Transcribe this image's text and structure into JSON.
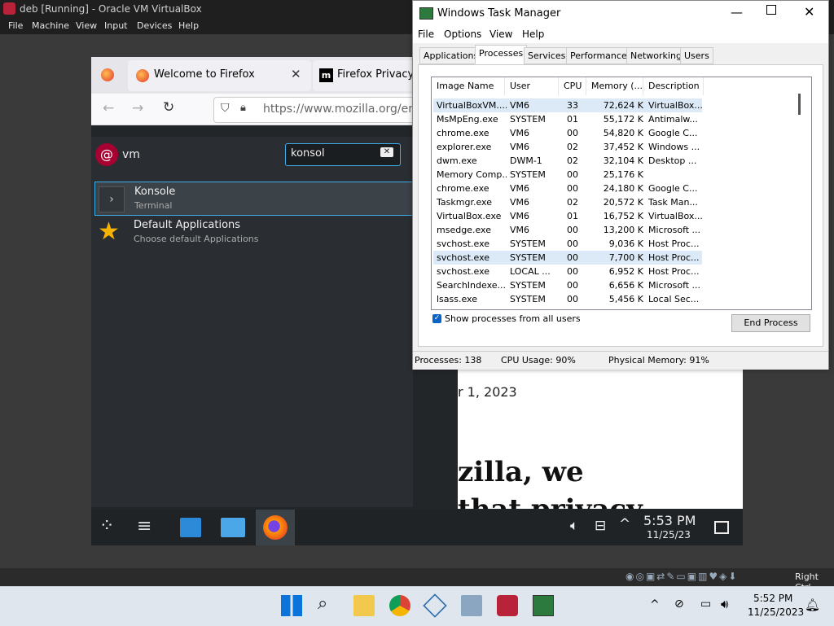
{
  "host": {
    "window_title": "deb [Running] - Oracle VM VirtualBox",
    "menu": [
      "File",
      "Machine",
      "View",
      "Input",
      "Devices",
      "Help"
    ],
    "status_right": "Right Ctrl",
    "taskbar": {
      "time": "5:52 PM",
      "date": "11/25/2023"
    }
  },
  "firefox": {
    "tabs": [
      {
        "label": "Welcome to Firefox"
      },
      {
        "label": "Firefox Privacy"
      }
    ],
    "url": "https://www.mozilla.org/en-",
    "page_date": "r 1, 2023",
    "page_heading_1": "zilla, we",
    "page_heading_2": "that privacy"
  },
  "krunner": {
    "app_label": "vm",
    "query": "konsol",
    "results": [
      {
        "title": "Konsole",
        "subtitle": "Terminal"
      },
      {
        "title": "Default Applications",
        "subtitle": "Choose default Applications"
      }
    ]
  },
  "guest_taskbar": {
    "time": "5:53 PM",
    "date": "11/25/23"
  },
  "task_manager": {
    "title": "Windows Task Manager",
    "menu": [
      "File",
      "Options",
      "View",
      "Help"
    ],
    "tabs": [
      "Applications",
      "Processes",
      "Services",
      "Performance",
      "Networking",
      "Users"
    ],
    "active_tab": "Processes",
    "columns": [
      "Image Name",
      "User Name",
      "CPU",
      "Memory (...",
      "Description"
    ],
    "rows": [
      [
        "VirtualBoxVM....",
        "VM6",
        "33",
        "72,624 K",
        "VirtualBox..."
      ],
      [
        "MsMpEng.exe",
        "SYSTEM",
        "01",
        "55,172 K",
        "Antimalw..."
      ],
      [
        "chrome.exe",
        "VM6",
        "00",
        "54,820 K",
        "Google C..."
      ],
      [
        "explorer.exe",
        "VM6",
        "02",
        "37,452 K",
        "Windows ..."
      ],
      [
        "dwm.exe",
        "DWM-1",
        "02",
        "32,104 K",
        "Desktop ..."
      ],
      [
        "Memory Comp...",
        "SYSTEM",
        "00",
        "25,176 K",
        ""
      ],
      [
        "chrome.exe",
        "VM6",
        "00",
        "24,180 K",
        "Google C..."
      ],
      [
        "Taskmgr.exe",
        "VM6",
        "02",
        "20,572 K",
        "Task Man..."
      ],
      [
        "VirtualBox.exe",
        "VM6",
        "01",
        "16,752 K",
        "VirtualBox..."
      ],
      [
        "msedge.exe",
        "VM6",
        "00",
        "13,200 K",
        "Microsoft ..."
      ],
      [
        "svchost.exe",
        "SYSTEM",
        "00",
        "9,036 K",
        "Host Proc..."
      ],
      [
        "svchost.exe",
        "SYSTEM",
        "00",
        "7,700 K",
        "Host Proc..."
      ],
      [
        "svchost.exe",
        "LOCAL ...",
        "00",
        "6,952 K",
        "Host Proc..."
      ],
      [
        "SearchIndexe...",
        "SYSTEM",
        "00",
        "6,656 K",
        "Microsoft ..."
      ],
      [
        "lsass.exe",
        "SYSTEM",
        "00",
        "5,456 K",
        "Local Sec..."
      ]
    ],
    "show_all_label": "Show processes from all users",
    "show_all_checked": true,
    "end_process_label": "End Process",
    "status": {
      "processes": "Processes: 138",
      "cpu": "CPU Usage: 90%",
      "memory": "Physical Memory: 91%"
    }
  }
}
